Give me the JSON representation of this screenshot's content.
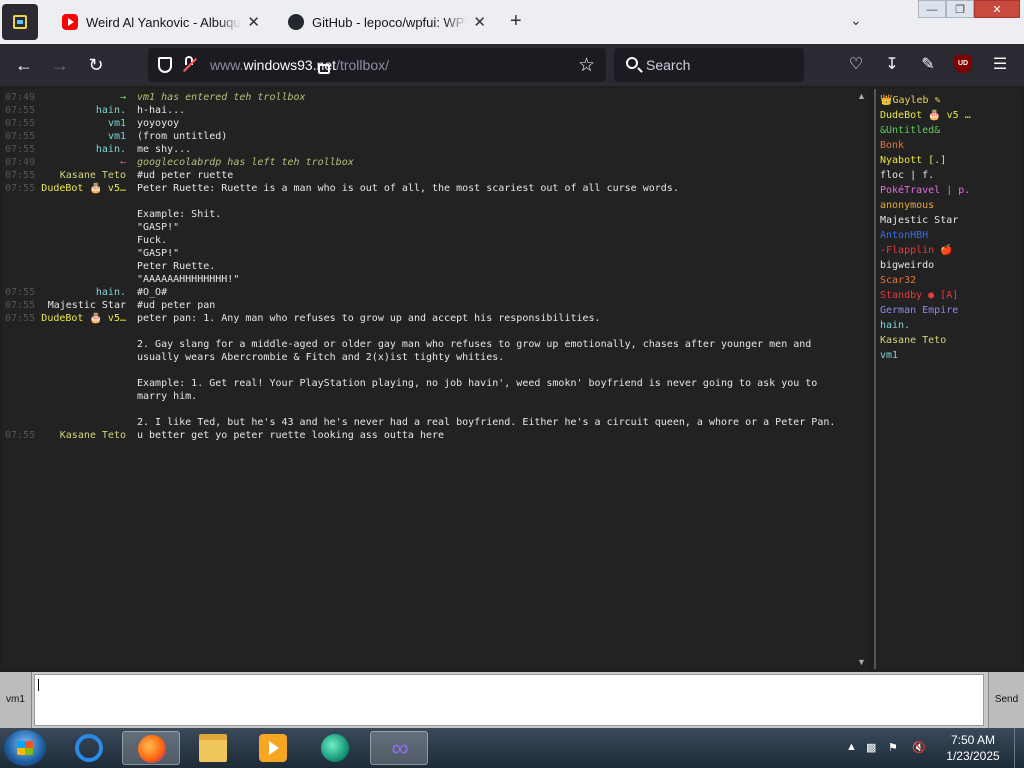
{
  "tabs": [
    {
      "title": "Weird Al Yankovic - Albuquerque",
      "favicon": "youtube-icon"
    },
    {
      "title": "GitHub - lepoco/wpfui: WPF UI",
      "favicon": "github-icon"
    }
  ],
  "window_controls": {
    "minimize": "—",
    "maximize": "❐",
    "close": "✕"
  },
  "urlbar": {
    "prefix": "www.",
    "host": "windows93.net",
    "path": "/trollbox/"
  },
  "search": {
    "label": "Search"
  },
  "toolbar_icons": [
    "pocket-icon",
    "download-icon",
    "extensions-icon",
    "ublock-icon",
    "menu-icon"
  ],
  "ublock_badge": "UD",
  "chat": {
    "messages": [
      {
        "time": "07:49",
        "nick": "→",
        "nick_color": "#7fd47f",
        "body": "vm1 has entered teh trollbox",
        "sys": true
      },
      {
        "time": "07:55",
        "nick": "hain.",
        "nick_color": "#7fd4d4",
        "body": "h-hai..."
      },
      {
        "time": "07:55",
        "nick": "vm1",
        "nick_color": "#7fd4d4",
        "body": "yoyoyoy"
      },
      {
        "time": "07:55",
        "nick": "vm1",
        "nick_color": "#7fd4d4",
        "body": "(from untitled)"
      },
      {
        "time": "07:55",
        "nick": "hain.",
        "nick_color": "#7fd4d4",
        "body": "me shy..."
      },
      {
        "time": "07:49",
        "nick": "←",
        "nick_color": "#ff5555",
        "body": "googlecolabrdp has left teh trollbox",
        "sys": true
      },
      {
        "time": "07:55",
        "nick": "Kasane Teto",
        "nick_color": "#d4d47f",
        "body": "#ud peter ruette"
      },
      {
        "time": "07:55",
        "nick": "DudeBot 🎂 v5…",
        "nick_color": "#e8e84a",
        "body": "Peter Ruette: Ruette is a man who is out of all, the most scariest out of all curse words.\n\nExample: Shit.\n\"GASP!\"\nFuck.\n\"GASP!\"\nPeter Ruette.\n\"AAAAAAHHHHHHHH!\""
      },
      {
        "time": "07:55",
        "nick": "hain.",
        "nick_color": "#7fd4d4",
        "body": "#O_O#"
      },
      {
        "time": "07:55",
        "nick": "Majestic Star",
        "nick_color": "#e6e6e6",
        "body": "#ud peter pan"
      },
      {
        "time": "07:55",
        "nick": "DudeBot 🎂 v5…",
        "nick_color": "#e8e84a",
        "body": "peter pan: 1. Any man who refuses to grow up and accept his responsibilities.\n\n2. Gay slang for a middle-aged or older gay man who refuses to grow up emotionally, chases after younger men and\nusually wears Abercrombie & Fitch and 2(x)ist tighty whities.\n\nExample: 1. Get real! Your PlayStation playing, no job havin', weed smokn' boyfriend is never going to ask you to\nmarry him.\n\n2. I like Ted, but he's 43 and he's never had a real boyfriend. Either he's a circuit queen, a whore or a Peter Pan."
      },
      {
        "time": "07:55",
        "nick": "Kasane Teto",
        "nick_color": "#d4d47f",
        "body": "u better get yo peter ruette looking ass outta here"
      }
    ]
  },
  "users": [
    {
      "name": "👑Gayleb ✎",
      "color": "#e8d45a"
    },
    {
      "name": "DudeBot 🎂 v5 …",
      "color": "#e8e84a"
    },
    {
      "name": "&Untitled&",
      "color": "#5ec95e"
    },
    {
      "name": "Bonk",
      "color": "#e8743a"
    },
    {
      "name": "Nyabott [.]",
      "color": "#e8e84a"
    },
    {
      "name": "floc | f.",
      "color": "#e6e6e6"
    },
    {
      "name": "PokéTravel | p.",
      "color": "#e86ae8"
    },
    {
      "name": "anonymous",
      "color": "#e8a83a"
    },
    {
      "name": "Majestic Star",
      "color": "#e6e6e6"
    },
    {
      "name": "AntonHBH",
      "color": "#3a6ae8"
    },
    {
      "name": "-Flapplin 🍎",
      "color": "#e83a3a"
    },
    {
      "name": "bigweirdo",
      "color": "#e6e6e6"
    },
    {
      "name": "Scar32",
      "color": "#e8743a"
    },
    {
      "name": "Standby ● [A]",
      "color": "#e83a3a"
    },
    {
      "name": "German Empire",
      "color": "#8a8ae8"
    },
    {
      "name": "hain.",
      "color": "#7fd4d4"
    },
    {
      "name": "Kasane Teto",
      "color": "#d4d47f"
    },
    {
      "name": "vm1",
      "color": "#7fd4d4"
    }
  ],
  "input": {
    "nick": "vm1",
    "send": "Send",
    "value": ""
  },
  "taskbar": {
    "apps": [
      "internet-explorer-icon",
      "firefox-icon",
      "folder-icon",
      "media-player-icon",
      "globe-icon",
      "visual-studio-icon"
    ],
    "time": "7:50 AM",
    "date": "1/23/2025"
  }
}
